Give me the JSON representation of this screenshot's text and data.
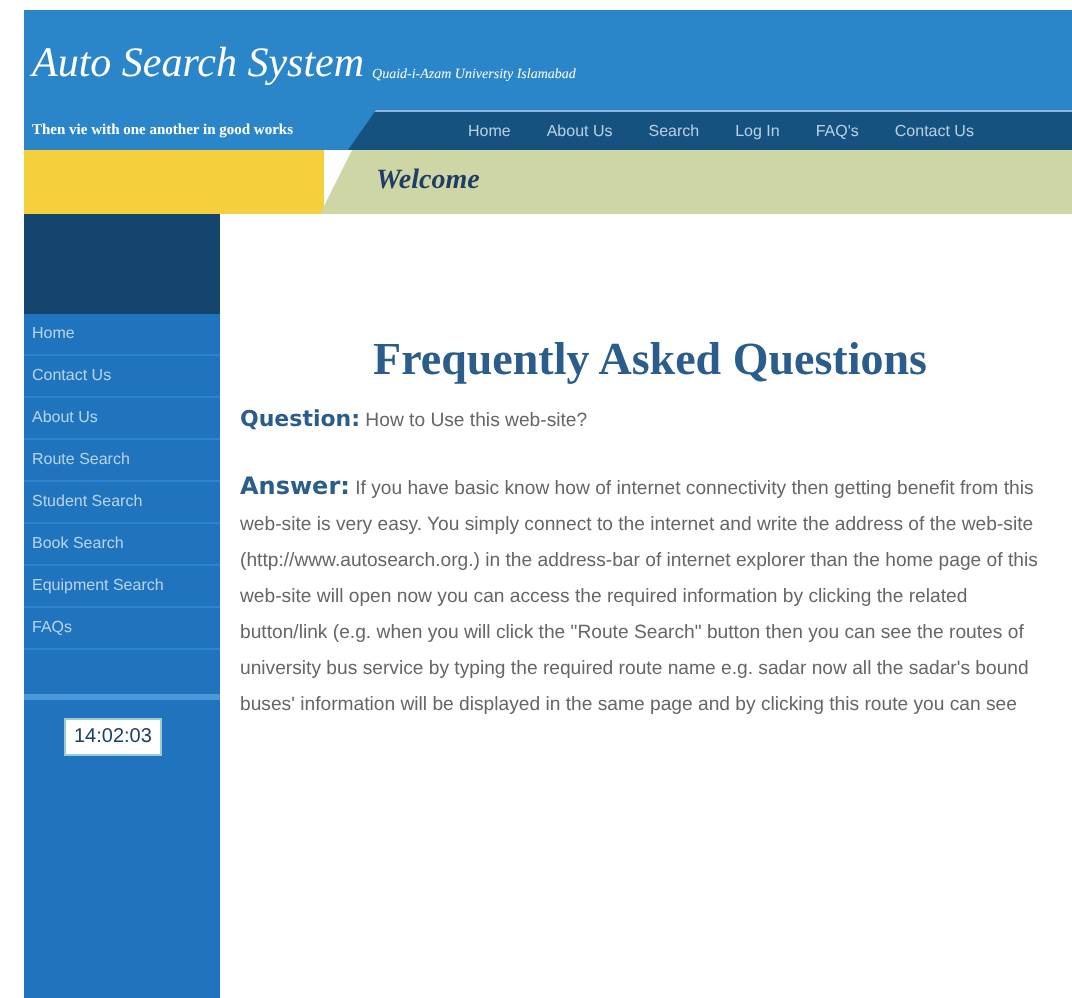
{
  "header": {
    "title": "Auto Search System",
    "subtitle": "Quaid-i-Azam University Islamabad",
    "motto": "Then vie with one another in good works"
  },
  "nav": [
    {
      "label": "Home"
    },
    {
      "label": "About Us"
    },
    {
      "label": "Search"
    },
    {
      "label": "Log In"
    },
    {
      "label": "FAQ's"
    },
    {
      "label": "Contact Us"
    }
  ],
  "banner": {
    "title": "Welcome"
  },
  "sidebar": {
    "items": [
      {
        "label": "Home"
      },
      {
        "label": "Contact Us"
      },
      {
        "label": "About Us"
      },
      {
        "label": "Route Search"
      },
      {
        "label": "Student Search"
      },
      {
        "label": "Book Search"
      },
      {
        "label": "Equipment Search"
      },
      {
        "label": "FAQs"
      }
    ],
    "clock": "14:02:03"
  },
  "content": {
    "heading": "Frequently Asked Questions",
    "question": {
      "text": "**Question:** How to Use this web-site?"
    },
    "answer": {
      "text": "**Answer:** If you have basic know how of internet connectivity then getting benefit from this web-site is very easy. You simply connect to the internet and write the address of the web-site (http://www.autosearch.org.) in the address-bar of internet explorer than the home page of this web-site will open now you can access the required information by clicking the related button/link (e.g. when you will click the \"Route Search\" button then you can see the routes of university bus service by typing the required route name e.g. sadar now all the sadar's bound buses' information will be displayed in the same page and by clicking this route you can see"
    }
  }
}
